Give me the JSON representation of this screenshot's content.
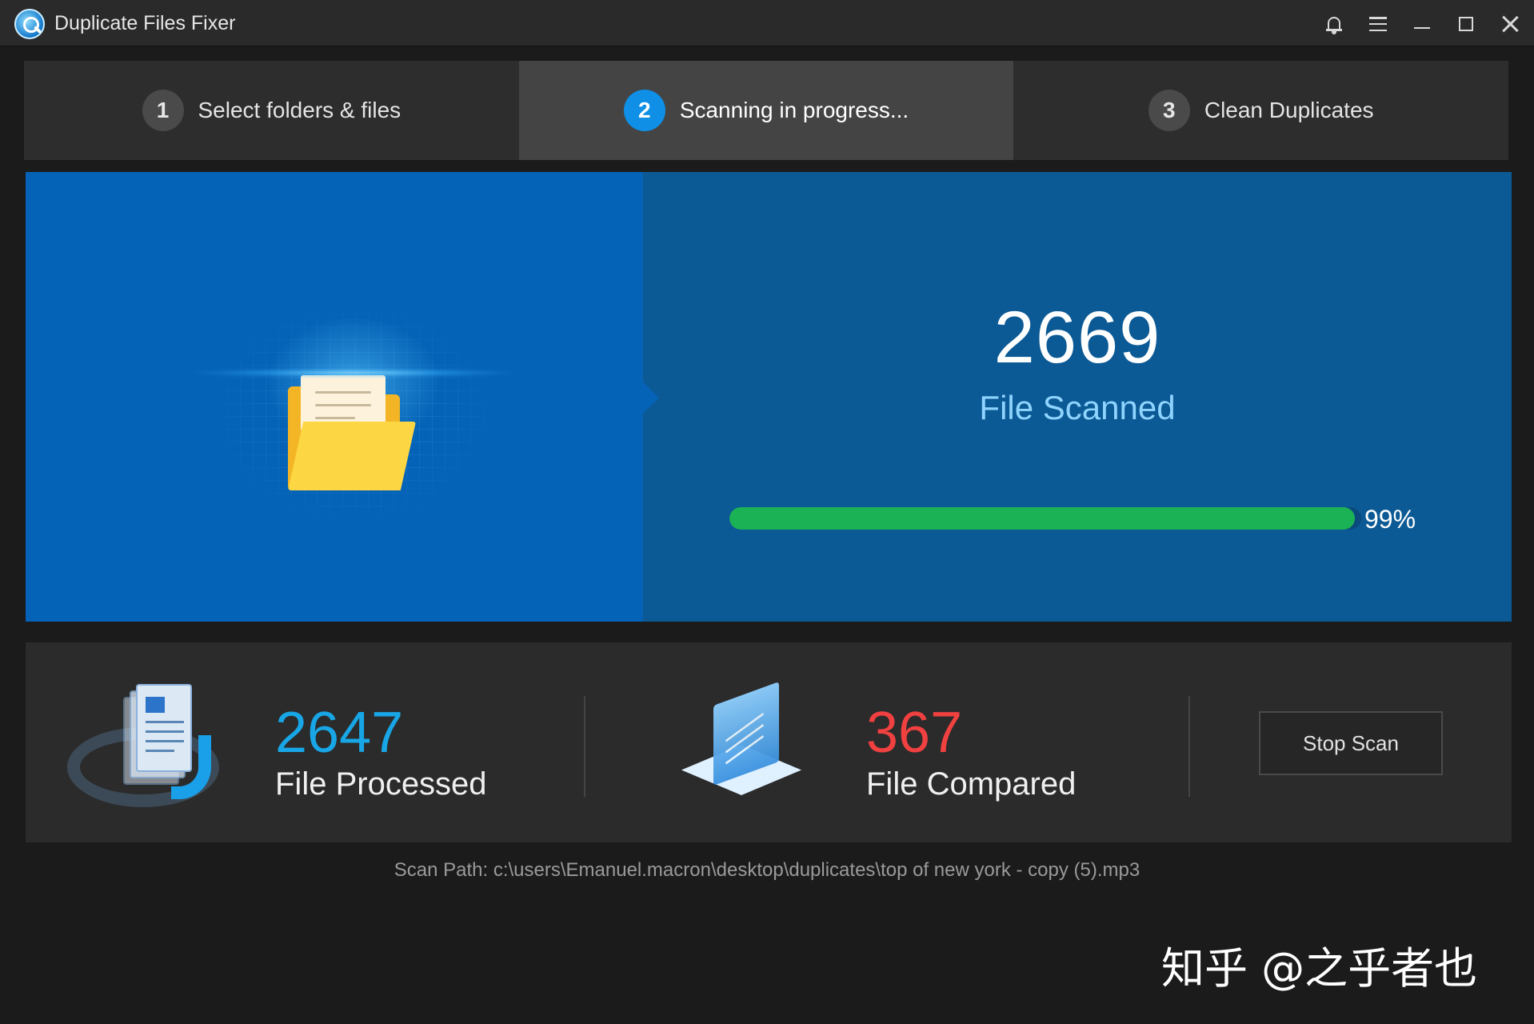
{
  "window": {
    "title": "Duplicate Files Fixer",
    "icons": [
      "bell-icon",
      "hamburger-menu-icon",
      "minimize-icon",
      "maximize-icon",
      "close-icon"
    ]
  },
  "steps": [
    {
      "number": "1",
      "label": "Select folders & files",
      "active": false
    },
    {
      "number": "2",
      "label": "Scanning in progress...",
      "active": true
    },
    {
      "number": "3",
      "label": "Clean Duplicates",
      "active": false
    }
  ],
  "scan": {
    "count": "2669",
    "label": "File Scanned",
    "progress_percent": 99,
    "progress_label": "99%"
  },
  "stats": {
    "processed": {
      "value": "2647",
      "label": "File Processed"
    },
    "compared": {
      "value": "367",
      "label": "File Compared"
    },
    "stop_label": "Stop Scan"
  },
  "scan_path": "Scan Path: c:\\users\\Emanuel.macron\\desktop\\duplicates\\top of new york - copy (5).mp3",
  "watermark": "知乎 @之乎者也",
  "colors": {
    "accent_blue": "#0f8fe6",
    "left_panel": "#0563b7",
    "right_panel": "#0c5a95",
    "progress_green": "#1bb255",
    "processed_blue": "#18a6e6",
    "compared_red": "#f04040"
  }
}
